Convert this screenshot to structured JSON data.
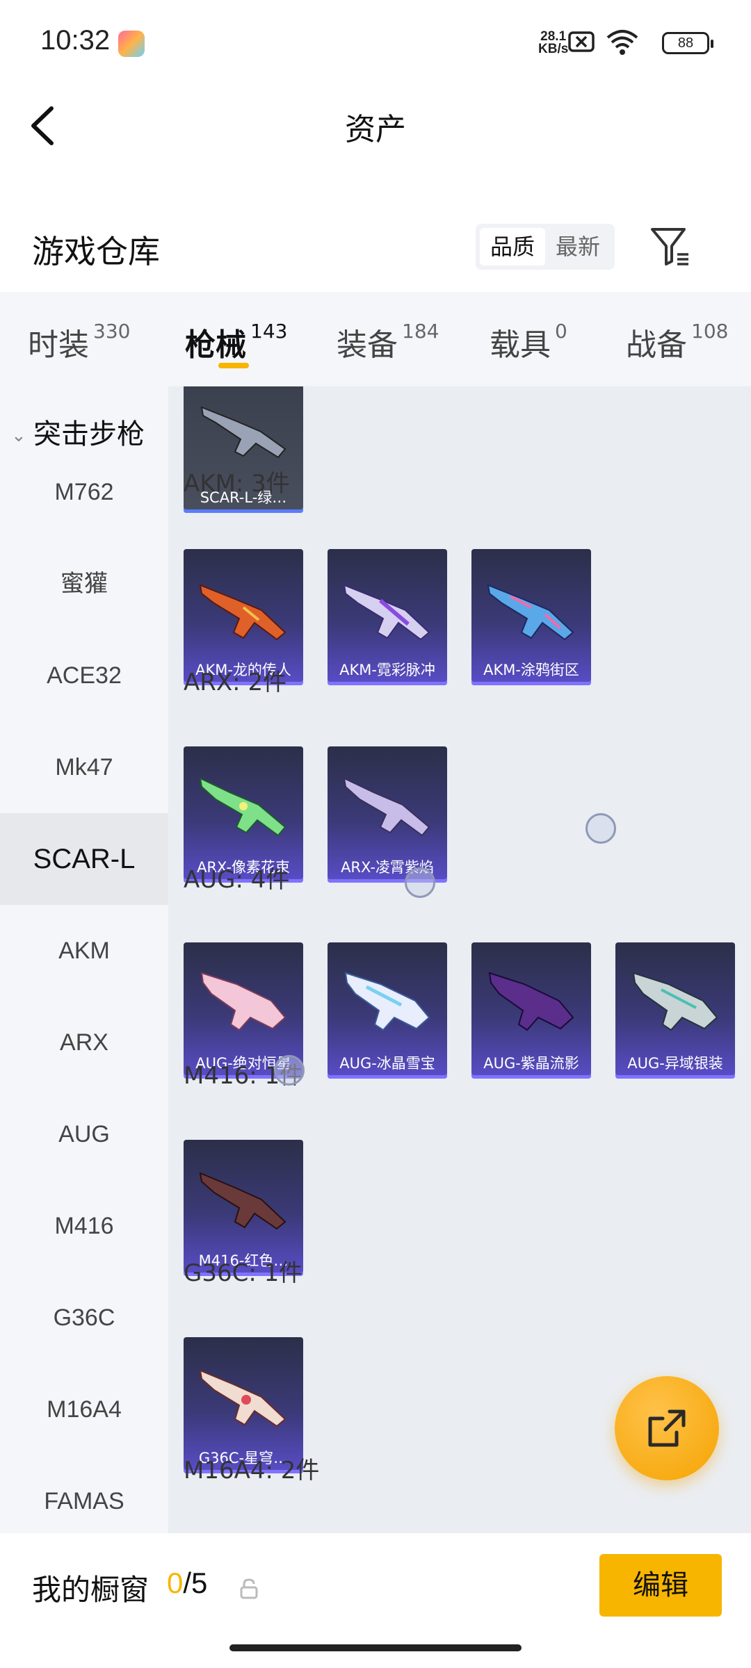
{
  "status_bar": {
    "time": "10:32",
    "net_speed_value": "28.1",
    "net_speed_unit": "KB/s",
    "battery": "88"
  },
  "header": {
    "title": "资产"
  },
  "warehouse": {
    "title": "游戏仓库",
    "sort_options": [
      "品质",
      "最新"
    ]
  },
  "tabs": [
    {
      "label": "时装",
      "count": "330"
    },
    {
      "label": "枪械",
      "count": "143",
      "active": true
    },
    {
      "label": "装备",
      "count": "184"
    },
    {
      "label": "载具",
      "count": "0"
    },
    {
      "label": "战备",
      "count": "108"
    }
  ],
  "sidebar": {
    "group": "突击步枪",
    "items": [
      "M762",
      "蜜獾",
      "ACE32",
      "Mk47",
      "SCAR-L",
      "AKM",
      "ARX",
      "AUG",
      "M416",
      "G36C",
      "M16A4",
      "FAMAS"
    ],
    "active": "SCAR-L"
  },
  "content": {
    "top_card": "SCAR-L-绿…",
    "sections": [
      {
        "label": "AKM: 3件",
        "items": [
          "AKM-龙的传人",
          "AKM-霓彩脉冲",
          "AKM-涂鸦街区"
        ]
      },
      {
        "label": "ARX: 2件",
        "items": [
          "ARX-像素花束",
          "ARX-凌霄紫焰"
        ]
      },
      {
        "label": "AUG: 4件",
        "items": [
          "AUG-绝对恒星",
          "AUG-冰晶雪宝",
          "AUG-紫晶流影",
          "AUG-异域银装"
        ]
      },
      {
        "label": "M416: 1件",
        "items": [
          "M416-红色…"
        ]
      },
      {
        "label": "G36C: 1件",
        "items": [
          "G36C-星穹…"
        ]
      },
      {
        "label": "M16A4: 2件",
        "items": []
      }
    ]
  },
  "bottom": {
    "showcase_label": "我的橱窗",
    "showcase_current": "0",
    "showcase_total": "/5",
    "edit_label": "编辑"
  },
  "colors": {
    "accent": "#f7b500",
    "card_gradient_end": "#5a4dc9",
    "content_bg": "#eaedf1"
  },
  "icons": [
    "game-app-icon",
    "no-sim-icon",
    "wifi-icon",
    "battery-icon",
    "back-arrow-icon",
    "filter-icon",
    "share-external-icon",
    "lock-icon",
    "chevron-down-icon",
    "rifle-icon"
  ]
}
